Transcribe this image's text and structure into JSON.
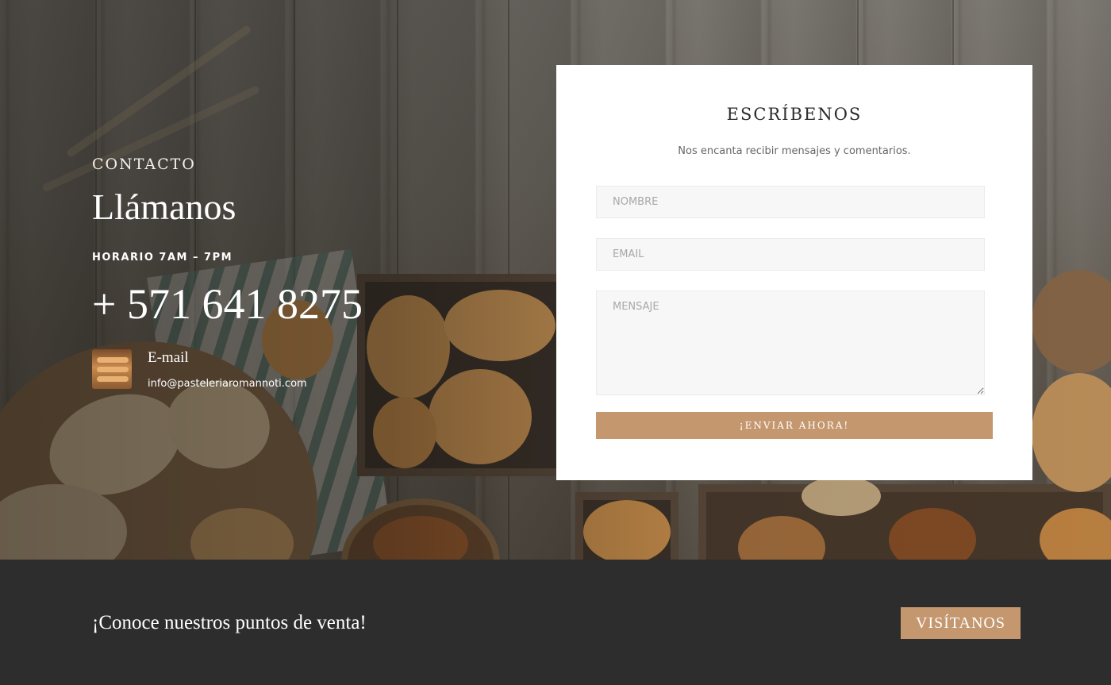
{
  "contact": {
    "eyebrow": "CONTACTO",
    "title": "Llámanos",
    "hours": "HORARIO 7AM – 7PM",
    "phone": "+ 571 641 8275",
    "email_label": "E-mail",
    "email_value": "info@pasteleriaromannoti.com",
    "thumbnail_icon": "bread-thumbnail-image"
  },
  "form": {
    "title": "ESCRÍBENOS",
    "subtitle": "Nos encanta recibir mensajes y comentarios.",
    "name_placeholder": "NOMBRE",
    "email_placeholder": "EMAIL",
    "message_placeholder": "MENSAJE",
    "submit_label": "¡ENVIAR AHORA!"
  },
  "footer_strip": {
    "text": "¡Conoce nuestros puntos de venta!",
    "button_label": "VISÍTANOS"
  },
  "colors": {
    "accent": "#c4976f",
    "dark_strip": "#2d2d2d",
    "card_bg": "#ffffff",
    "field_bg": "#f7f7f7"
  }
}
